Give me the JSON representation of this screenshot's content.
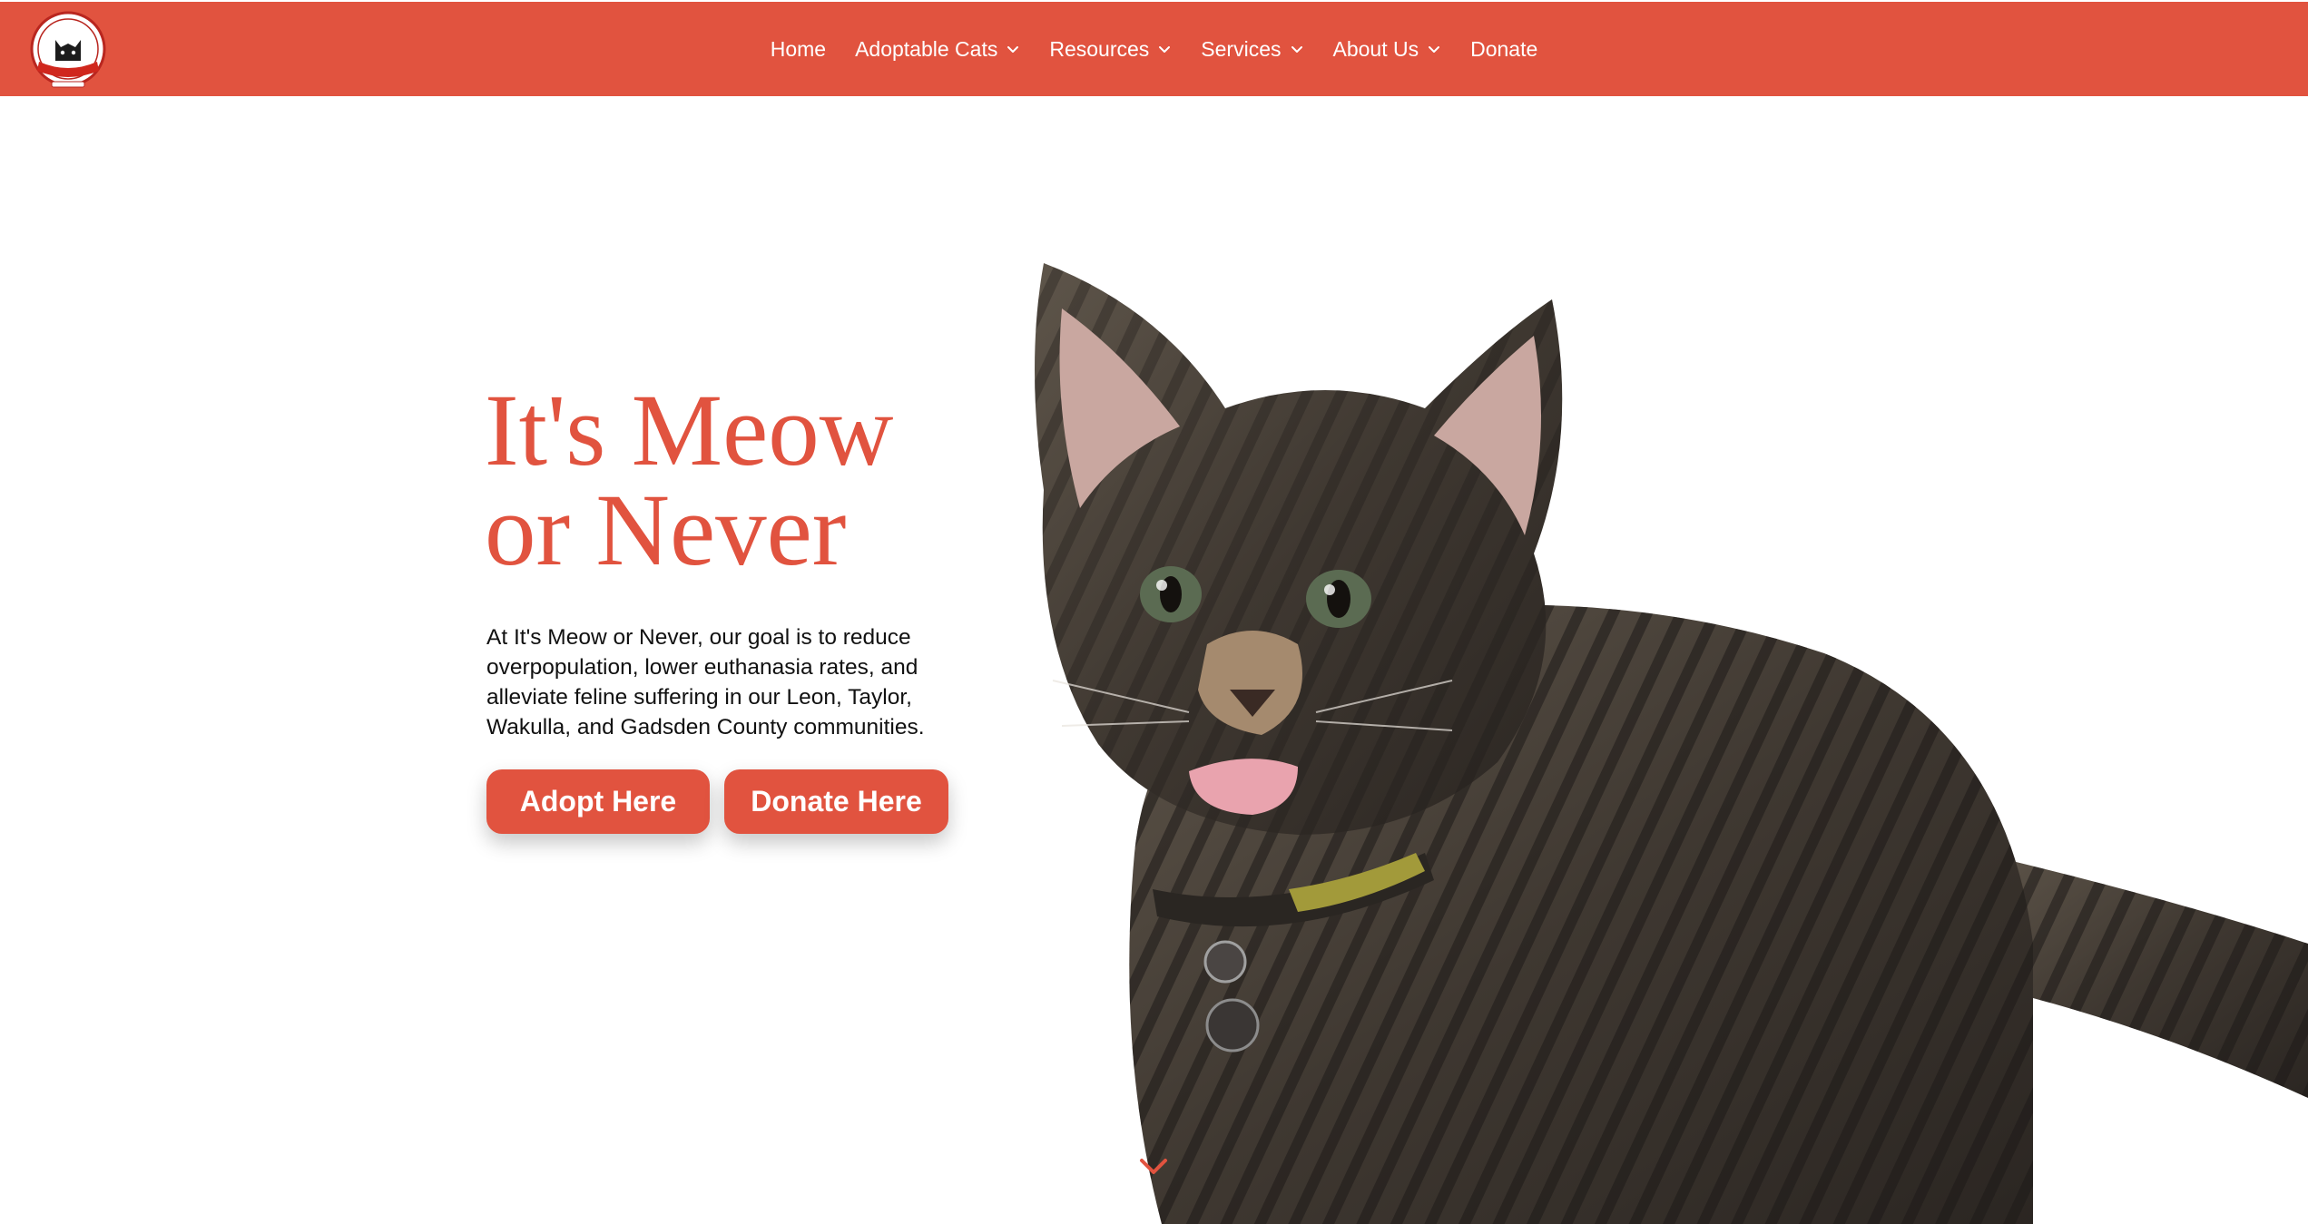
{
  "header": {
    "logo_icon": "cat-logo-icon",
    "nav": [
      {
        "label": "Home",
        "dropdown": false
      },
      {
        "label": "Adoptable Cats",
        "dropdown": true
      },
      {
        "label": "Resources",
        "dropdown": true
      },
      {
        "label": "Services",
        "dropdown": true
      },
      {
        "label": "About Us",
        "dropdown": true
      },
      {
        "label": "Donate",
        "dropdown": false
      }
    ]
  },
  "hero": {
    "title_line1": "It's Meow",
    "title_line2": "or Never",
    "description": "At It's Meow or Never, our goal is to reduce overpopulation, lower euthanasia rates, and alleviate feline suffering in our Leon, Taylor, Wakulla, and Gadsden County communities.",
    "adopt_label": "Adopt Here",
    "donate_label": "Donate Here",
    "image_icon": "tabby-kitten-image",
    "scroll_icon": "chevron-down-icon"
  },
  "colors": {
    "brand": "#e1533f",
    "nav_text": "#ffffff",
    "body_text": "#111111"
  }
}
